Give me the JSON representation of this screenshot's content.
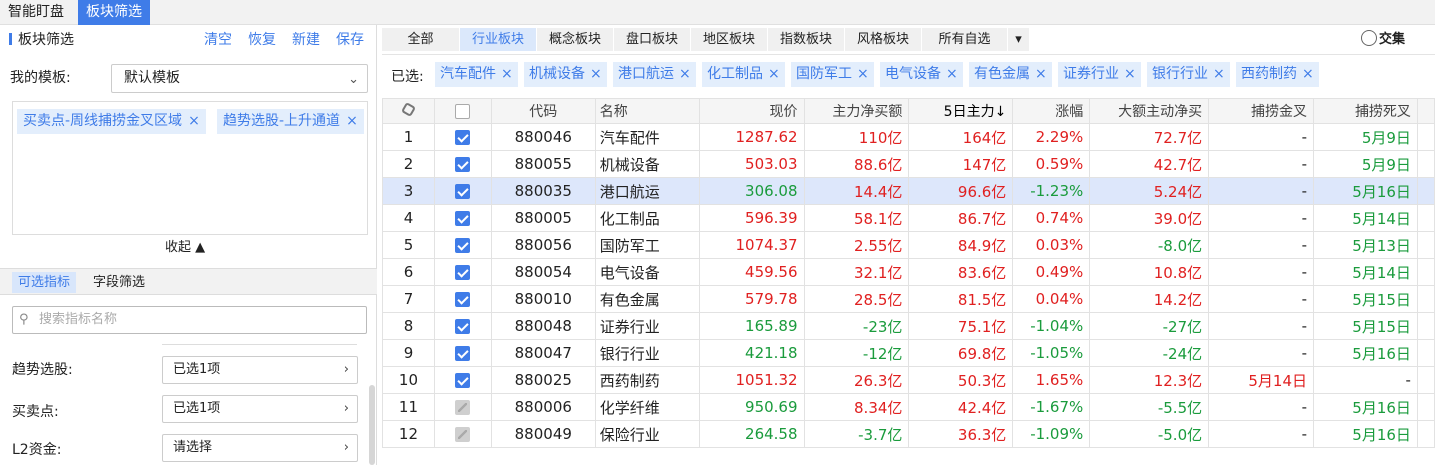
{
  "topbar": {
    "tabs": [
      "智能盯盘",
      "板块筛选"
    ]
  },
  "left": {
    "title": "板块筛选",
    "actions": [
      "清空",
      "恢复",
      "新建",
      "保存"
    ],
    "template_label": "我的模板:",
    "template_value": "默认模板",
    "tags": [
      "买卖点-周线捕捞金叉区域",
      "趋势选股-上升通道"
    ],
    "collapse": "收起 ▲",
    "subtabs": [
      "可选指标",
      "字段筛选"
    ],
    "search_placeholder": "搜索指标名称",
    "filters": [
      {
        "label": "趋势选股:",
        "value": "已选1项"
      },
      {
        "label": "买卖点:",
        "value": "已选1项"
      },
      {
        "label": "L2资金:",
        "value": "请选择"
      }
    ]
  },
  "right": {
    "tabs": [
      "全部",
      "行业板块",
      "概念板块",
      "盘口板块",
      "地区板块",
      "指数板块",
      "风格板块",
      "所有自选"
    ],
    "active_tab": 1,
    "intersection_label": "交集",
    "selected_label": "已选:",
    "selected_tags": [
      "汽车配件",
      "机械设备",
      "港口航运",
      "化工制品",
      "国防军工",
      "电气设备",
      "有色金属",
      "证券行业",
      "银行行业",
      "西药制药"
    ],
    "columns": [
      "",
      "",
      "代码",
      "名称",
      "现价",
      "主力净买额",
      "5日主力↓",
      "涨幅",
      "大额主动净买",
      "捕捞金叉",
      "捕捞死叉"
    ],
    "rows": [
      {
        "idx": "1",
        "chk": "on",
        "code": "880046",
        "name": "汽车配件",
        "price": "1287.62",
        "net": "110亿",
        "five": "164亿",
        "chg": "2.29%",
        "big": "72.7亿",
        "gold": "-",
        "dead": "5月9日"
      },
      {
        "idx": "2",
        "chk": "on",
        "code": "880055",
        "name": "机械设备",
        "price": "503.03",
        "net": "88.6亿",
        "five": "147亿",
        "chg": "0.59%",
        "big": "42.7亿",
        "gold": "-",
        "dead": "5月9日"
      },
      {
        "idx": "3",
        "chk": "on",
        "code": "880035",
        "name": "港口航运",
        "price": "306.08",
        "net": "14.4亿",
        "five": "96.6亿",
        "chg": "-1.23%",
        "big": "5.24亿",
        "gold": "-",
        "dead": "5月16日"
      },
      {
        "idx": "4",
        "chk": "on",
        "code": "880005",
        "name": "化工制品",
        "price": "596.39",
        "net": "58.1亿",
        "five": "86.7亿",
        "chg": "0.74%",
        "big": "39.0亿",
        "gold": "-",
        "dead": "5月14日"
      },
      {
        "idx": "5",
        "chk": "on",
        "code": "880056",
        "name": "国防军工",
        "price": "1074.37",
        "net": "2.55亿",
        "five": "84.9亿",
        "chg": "0.03%",
        "big": "-8.0亿",
        "gold": "-",
        "dead": "5月13日"
      },
      {
        "idx": "6",
        "chk": "on",
        "code": "880054",
        "name": "电气设备",
        "price": "459.56",
        "net": "32.1亿",
        "five": "83.6亿",
        "chg": "0.49%",
        "big": "10.8亿",
        "gold": "-",
        "dead": "5月14日"
      },
      {
        "idx": "7",
        "chk": "on",
        "code": "880010",
        "name": "有色金属",
        "price": "579.78",
        "net": "28.5亿",
        "five": "81.5亿",
        "chg": "0.04%",
        "big": "14.2亿",
        "gold": "-",
        "dead": "5月15日"
      },
      {
        "idx": "8",
        "chk": "on",
        "code": "880048",
        "name": "证券行业",
        "price": "165.89",
        "net": "-23亿",
        "five": "75.1亿",
        "chg": "-1.04%",
        "big": "-27亿",
        "gold": "-",
        "dead": "5月15日"
      },
      {
        "idx": "9",
        "chk": "on",
        "code": "880047",
        "name": "银行行业",
        "price": "421.18",
        "net": "-12亿",
        "five": "69.8亿",
        "chg": "-1.05%",
        "big": "-24亿",
        "gold": "-",
        "dead": "5月16日"
      },
      {
        "idx": "10",
        "chk": "on",
        "code": "880025",
        "name": "西药制药",
        "price": "1051.32",
        "net": "26.3亿",
        "five": "50.3亿",
        "chg": "1.65%",
        "big": "12.3亿",
        "gold": "5月14日",
        "dead": "-"
      },
      {
        "idx": "11",
        "chk": "dis",
        "code": "880006",
        "name": "化学纤维",
        "price": "950.69",
        "net": "8.34亿",
        "five": "42.4亿",
        "chg": "-1.67%",
        "big": "-5.5亿",
        "gold": "-",
        "dead": "5月16日"
      },
      {
        "idx": "12",
        "chk": "dis",
        "code": "880049",
        "name": "保险行业",
        "price": "264.58",
        "net": "-3.7亿",
        "five": "36.3亿",
        "chg": "-1.09%",
        "big": "-5.0亿",
        "gold": "-",
        "dead": "5月16日"
      }
    ],
    "highlighted_row": 2
  },
  "colors": {
    "accent": "#3f7ce8",
    "up": "#e02020",
    "down": "#1a9b3c",
    "highlight": "#dde7fb"
  }
}
